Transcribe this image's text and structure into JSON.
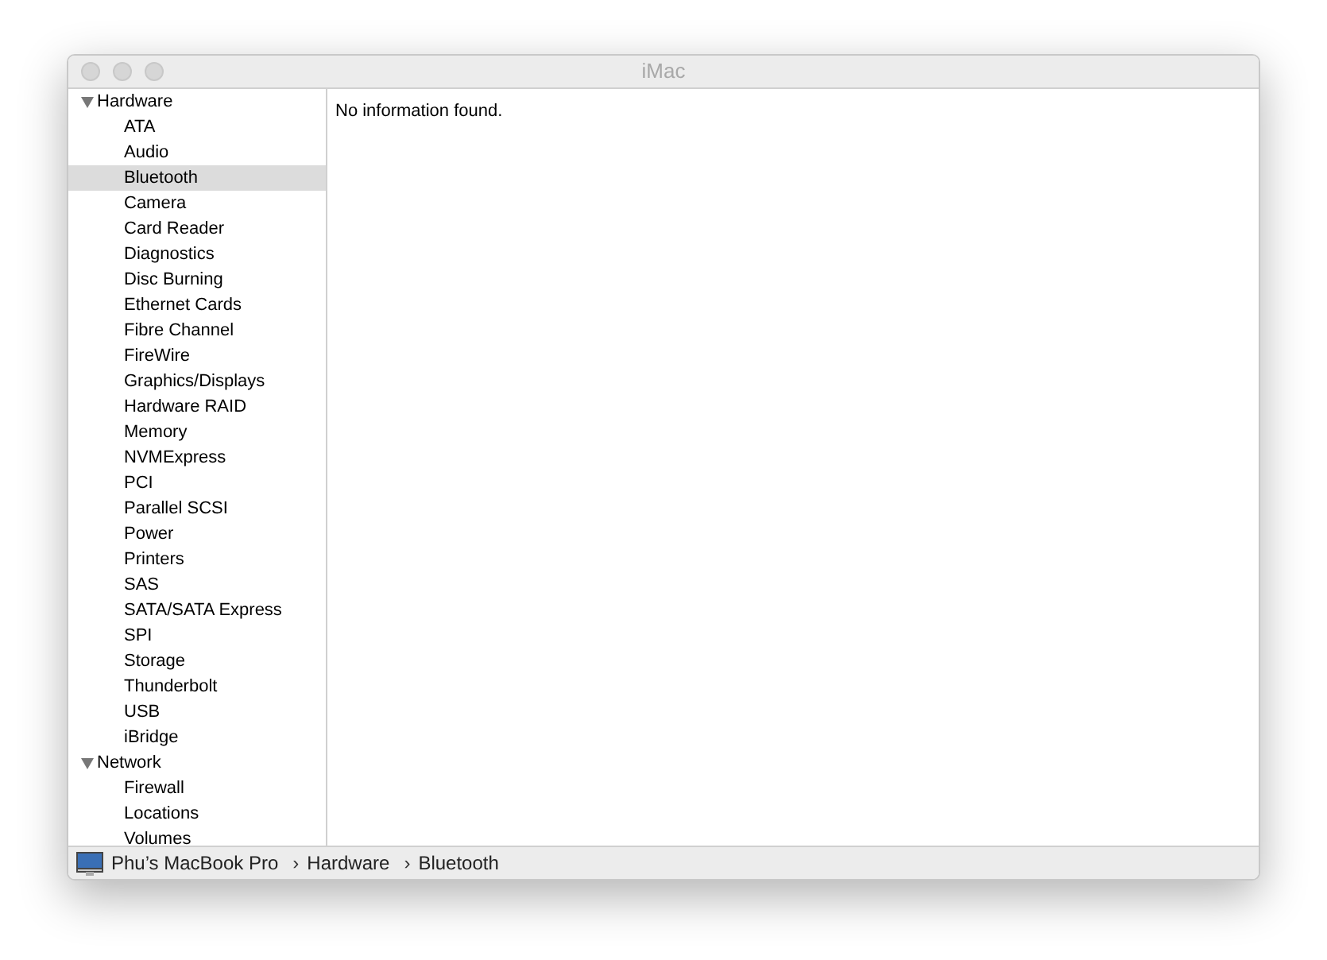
{
  "window": {
    "title": "iMac"
  },
  "sidebar": {
    "items": [
      {
        "label": "Hardware",
        "expanded": true,
        "selected": false,
        "children": [
          {
            "label": "ATA",
            "selected": false
          },
          {
            "label": "Audio",
            "selected": false
          },
          {
            "label": "Bluetooth",
            "selected": true
          },
          {
            "label": "Camera",
            "selected": false
          },
          {
            "label": "Card Reader",
            "selected": false
          },
          {
            "label": "Diagnostics",
            "selected": false
          },
          {
            "label": "Disc Burning",
            "selected": false
          },
          {
            "label": "Ethernet Cards",
            "selected": false
          },
          {
            "label": "Fibre Channel",
            "selected": false
          },
          {
            "label": "FireWire",
            "selected": false
          },
          {
            "label": "Graphics/Displays",
            "selected": false
          },
          {
            "label": "Hardware RAID",
            "selected": false
          },
          {
            "label": "Memory",
            "selected": false
          },
          {
            "label": "NVMExpress",
            "selected": false
          },
          {
            "label": "PCI",
            "selected": false
          },
          {
            "label": "Parallel SCSI",
            "selected": false
          },
          {
            "label": "Power",
            "selected": false
          },
          {
            "label": "Printers",
            "selected": false
          },
          {
            "label": "SAS",
            "selected": false
          },
          {
            "label": "SATA/SATA Express",
            "selected": false
          },
          {
            "label": "SPI",
            "selected": false
          },
          {
            "label": "Storage",
            "selected": false
          },
          {
            "label": "Thunderbolt",
            "selected": false
          },
          {
            "label": "USB",
            "selected": false
          },
          {
            "label": "iBridge",
            "selected": false
          }
        ]
      },
      {
        "label": "Network",
        "expanded": true,
        "selected": false,
        "children": [
          {
            "label": "Firewall",
            "selected": false
          },
          {
            "label": "Locations",
            "selected": false
          },
          {
            "label": "Volumes",
            "selected": false
          }
        ]
      }
    ]
  },
  "content": {
    "message": "No information found."
  },
  "status_bar": {
    "path": [
      "Phu’s MacBook Pro",
      "Hardware",
      "Bluetooth"
    ],
    "separator": "›"
  }
}
